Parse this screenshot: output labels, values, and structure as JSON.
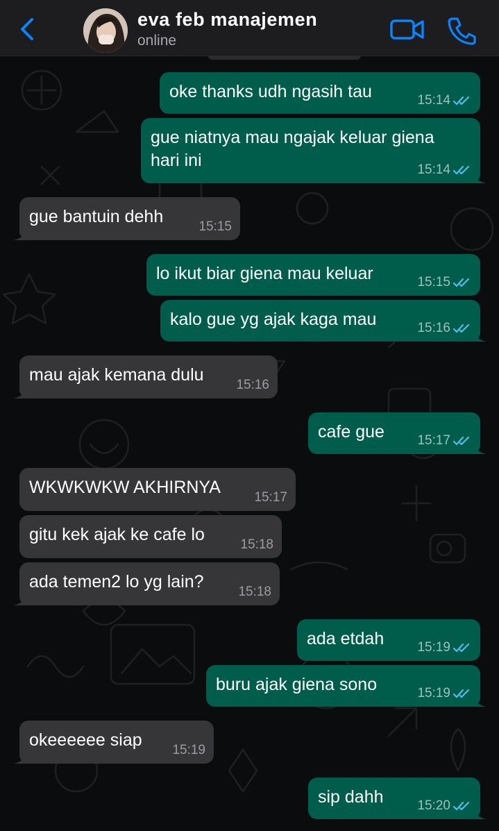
{
  "header": {
    "contact_name": "eva feb manajemen",
    "status": "online",
    "back_icon": "chevron-left-icon",
    "video_icon": "video-camera-icon",
    "call_icon": "phone-icon"
  },
  "colors": {
    "header_bg": "#1d1d1f",
    "accent": "#0a84ff",
    "outgoing_bubble": "#005c4b",
    "incoming_bubble": "#363638",
    "read_tick": "#53bdeb"
  },
  "messages": [
    {
      "dir": "out",
      "text": "oke thanks udh ngasih tau",
      "time": "15:14",
      "read": true
    },
    {
      "dir": "out",
      "text": "gue niatnya mau ngajak keluar giena\nhari ini",
      "time": "15:14",
      "read": true
    },
    {
      "dir": "in",
      "text": "gue bantuin dehh",
      "time": "15:15"
    },
    {
      "dir": "out",
      "text": "lo ikut biar giena mau keluar",
      "time": "15:15",
      "read": true
    },
    {
      "dir": "out",
      "text": "kalo gue yg ajak kaga mau",
      "time": "15:16",
      "read": true
    },
    {
      "dir": "in",
      "text": "mau ajak kemana dulu",
      "time": "15:16"
    },
    {
      "dir": "out",
      "text": "cafe gue",
      "time": "15:17",
      "read": true
    },
    {
      "dir": "in",
      "text": "WKWKWKW AKHIRNYA",
      "time": "15:17"
    },
    {
      "dir": "in",
      "text": "gitu kek ajak ke cafe lo",
      "time": "15:18"
    },
    {
      "dir": "in",
      "text": "ada temen2 lo yg lain?",
      "time": "15:18"
    },
    {
      "dir": "out",
      "text": "ada etdah",
      "time": "15:19",
      "read": true
    },
    {
      "dir": "out",
      "text": "buru ajak giena sono",
      "time": "15:19",
      "read": true
    },
    {
      "dir": "in",
      "text": "okeeeeee siap",
      "time": "15:19"
    },
    {
      "dir": "out",
      "text": "sip dahh",
      "time": "15:20",
      "read": true
    }
  ]
}
